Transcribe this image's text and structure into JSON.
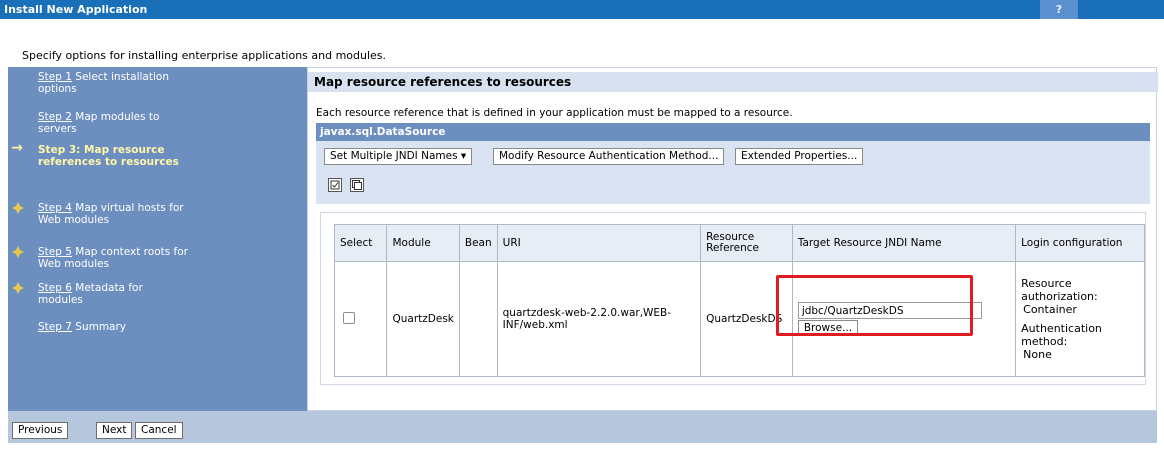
{
  "window": {
    "title": "Install New Application",
    "help_label": "?"
  },
  "intro": "Specify options for installing enterprise applications and modules.",
  "steps": [
    {
      "link": "Step 1",
      "rest": " Select installation options"
    },
    {
      "link": "Step 2",
      "rest": " Map modules to servers"
    },
    {
      "label": "Step 3: Map resource references to resources"
    },
    {
      "link": "Step 4",
      "rest": " Map virtual hosts for Web modules"
    },
    {
      "link": "Step 5",
      "rest": " Map context roots for Web modules"
    },
    {
      "link": "Step 6",
      "rest": " Metadata for modules"
    },
    {
      "link": "Step 7",
      "rest": " Summary"
    }
  ],
  "main": {
    "title": "Map resource references to resources",
    "description": "Each resource reference that is defined in your application must be mapped to a resource.",
    "section": "javax.sql.DataSource",
    "toolbar": {
      "set_jndi": "Set Multiple JNDI Names ▾",
      "modify_auth": "Modify Resource Authentication Method...",
      "ext_props": "Extended Properties..."
    }
  },
  "table": {
    "headers": [
      "Select",
      "Module",
      "Bean",
      "URI",
      "Resource Reference",
      "Target Resource JNDI Name",
      "Login configuration"
    ],
    "row": {
      "module": "QuartzDesk",
      "bean": "",
      "uri": "quartzdesk-web-2.2.0.war,WEB-INF/web.xml",
      "resource_reference": "QuartzDeskDS",
      "jndi_value": "jdbc/QuartzDeskDS",
      "browse": "Browse...",
      "login_res_auth_label": "Resource authorization:",
      "login_res_auth_value": "Container",
      "login_auth_method_label": "Authentication method:",
      "login_auth_method_value": "None"
    }
  },
  "buttons": {
    "previous": "Previous",
    "next": "Next",
    "cancel": "Cancel"
  }
}
